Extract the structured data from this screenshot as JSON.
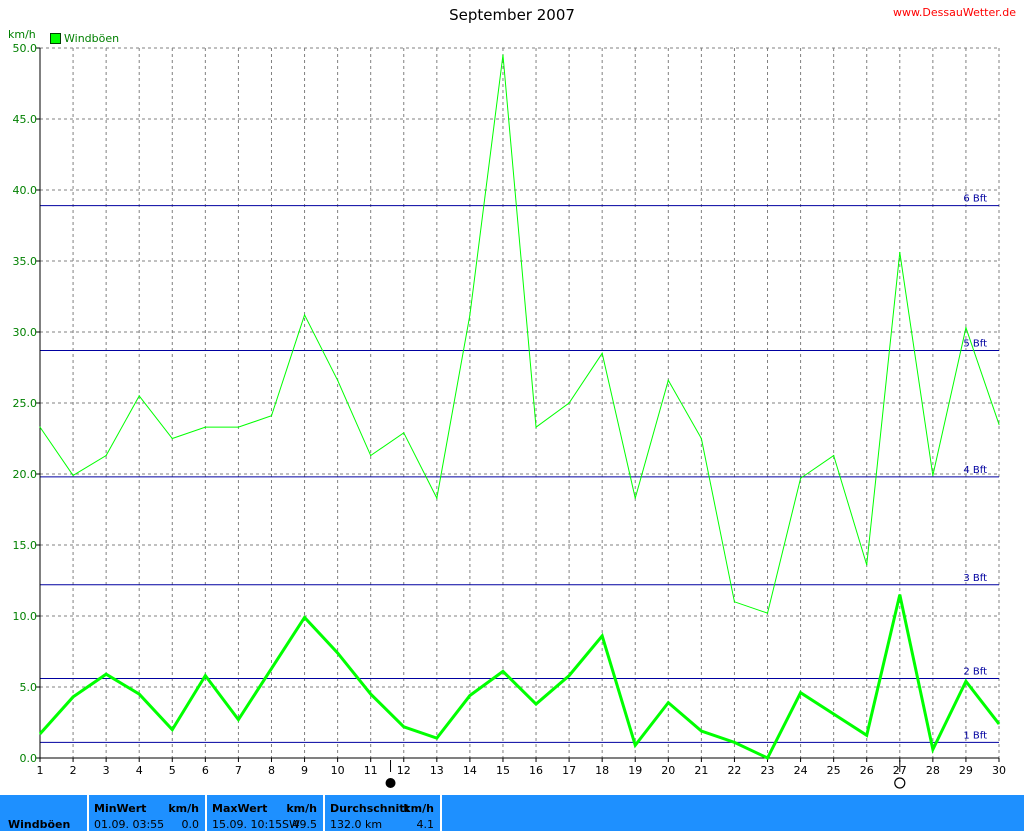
{
  "header": {
    "title": "September 2007",
    "site": "www.DessauWetter.de",
    "unit": "km/h",
    "legend_label": "Windböen",
    "legend_color": "#00ff00"
  },
  "chart_data": {
    "type": "line",
    "title": "September 2007",
    "ylabel": "km/h",
    "ylim": [
      0,
      50
    ],
    "y_ticks": [
      "0.0",
      "5.0",
      "10.0",
      "15.0",
      "20.0",
      "25.0",
      "30.0",
      "35.0",
      "40.0",
      "45.0",
      "50.0"
    ],
    "x": [
      1,
      2,
      3,
      4,
      5,
      6,
      7,
      8,
      9,
      10,
      11,
      12,
      13,
      14,
      15,
      16,
      17,
      18,
      19,
      20,
      21,
      22,
      23,
      24,
      25,
      26,
      27,
      28,
      29,
      30
    ],
    "grid": true,
    "series": [
      {
        "name": "Windböen",
        "color": "#00ff00",
        "values": [
          23.3,
          19.9,
          21.3,
          25.5,
          22.5,
          23.3,
          23.3,
          24.1,
          31.2,
          26.6,
          21.3,
          22.9,
          18.3,
          31.2,
          49.5,
          23.3,
          25.0,
          28.5,
          18.3,
          26.6,
          22.5,
          11.0,
          10.2,
          19.7,
          21.3,
          13.6,
          35.6,
          19.9,
          30.3,
          23.5
        ],
        "width": 1
      },
      {
        "values": [
          1.7,
          4.3,
          5.9,
          4.5,
          2.0,
          5.8,
          2.7,
          6.3,
          9.9,
          7.4,
          4.5,
          2.2,
          1.4,
          4.4,
          6.1,
          3.8,
          5.8,
          8.6,
          0.9,
          3.9,
          1.9,
          1.1,
          0.0,
          4.6,
          3.1,
          1.6,
          11.5,
          0.6,
          5.4,
          2.4
        ],
        "color": "#00ff00",
        "width": 3
      }
    ],
    "reference_lines": [
      {
        "label": "1 Bft",
        "value": 1.1
      },
      {
        "label": "2 Bft",
        "value": 5.6
      },
      {
        "label": "3 Bft",
        "value": 12.2
      },
      {
        "label": "4 Bft",
        "value": 19.8
      },
      {
        "label": "5 Bft",
        "value": 28.7
      },
      {
        "label": "6 Bft",
        "value": 38.9
      }
    ],
    "reference_color": "#0000a0",
    "moon_markers": [
      {
        "phase": "new-moon",
        "x": 11.6
      },
      {
        "phase": "full-moon",
        "x": 27.0
      }
    ]
  },
  "stats": {
    "name": "Windböen",
    "min_head": "MinWert",
    "min_unit": "km/h",
    "min_date": "01.09.  03:55",
    "min_value": "0.0",
    "max_head": "MaxWert",
    "max_unit": "km/h",
    "max_date": "15.09.  10:15",
    "max_dir": "SW",
    "max_value": "49.5",
    "avg_head": "Durchschnitt",
    "avg_unit": "km/h",
    "avg_dist": "132.0 km",
    "avg_value": "4.1"
  }
}
